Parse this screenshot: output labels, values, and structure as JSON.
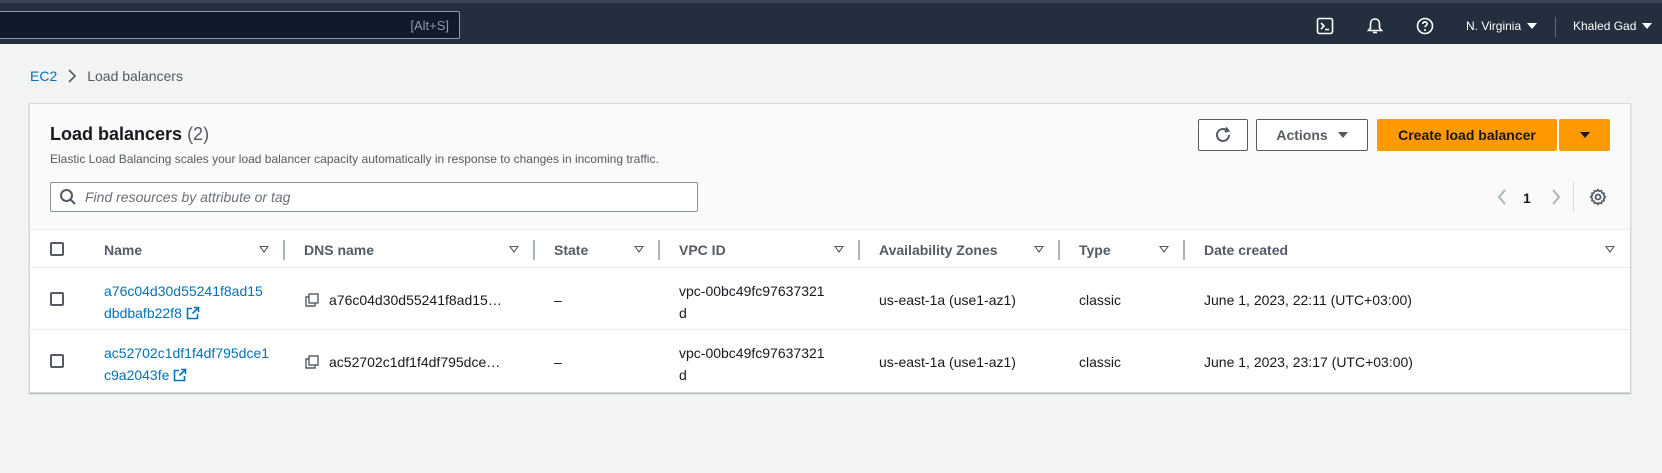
{
  "topnav": {
    "search_shortcut": "[Alt+S]",
    "region": "N. Virginia",
    "user": "Khaled Gad"
  },
  "breadcrumb": {
    "root": "EC2",
    "current": "Load balancers"
  },
  "panel": {
    "title": "Load balancers",
    "count": "(2)",
    "description": "Elastic Load Balancing scales your load balancer capacity automatically in response to changes in incoming traffic.",
    "actions_label": "Actions",
    "create_label": "Create load balancer",
    "filter_placeholder": "Find resources by attribute or tag",
    "page_number": "1"
  },
  "table": {
    "columns": [
      "Name",
      "DNS name",
      "State",
      "VPC ID",
      "Availability Zones",
      "Type",
      "Date created"
    ],
    "rows": [
      {
        "name": "a76c04d30d55241f8ad15dbdbafb22f8",
        "dns": "a76c04d30d55241f8ad15…",
        "state": "–",
        "vpc": "vpc-00bc49fc97637321d",
        "az": "us-east-1a (use1-az1)",
        "type": "classic",
        "date": "June 1, 2023, 22:11 (UTC+03:00)"
      },
      {
        "name": "ac52702c1df1f4df795dce1c9a2043fe",
        "dns": "ac52702c1df1f4df795dce…",
        "state": "–",
        "vpc": "vpc-00bc49fc97637321d",
        "az": "us-east-1a (use1-az1)",
        "type": "classic",
        "date": "June 1, 2023, 23:17 (UTC+03:00)"
      }
    ]
  },
  "icons": {
    "cloudshell": "cloudshell-icon",
    "notifications": "bell-icon",
    "help": "help-icon",
    "refresh": "refresh-icon",
    "settings": "gear-icon",
    "search": "search-icon",
    "external": "external-link-icon",
    "copy": "copy-icon"
  }
}
